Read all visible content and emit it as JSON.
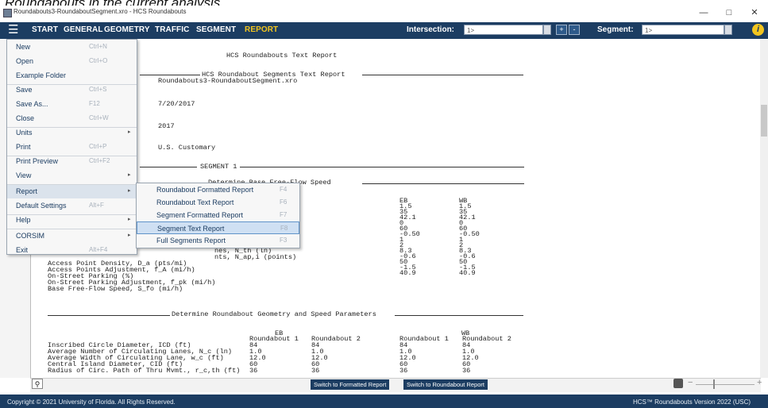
{
  "caption": "Roundabouts in the current analysis.",
  "window": {
    "title": "Roundabouts3-RoundaboutSegment.xro - HCS Roundabouts",
    "controls": {
      "minimize": "—",
      "maximize": "□",
      "close": "✕"
    }
  },
  "ribbon": {
    "menu_icon": "hamburger-icon",
    "tabs": [
      "START",
      "GENERAL",
      "GEOMETRY",
      "TRAFFIC",
      "SEGMENT",
      "REPORT"
    ],
    "active_tab": "REPORT",
    "intersection_label": "Intersection:",
    "intersection_value": "1>",
    "segment_label": "Segment:",
    "segment_value": "1>",
    "add_label": "+",
    "remove_label": "-",
    "info_label": "i"
  },
  "file_menu": {
    "items": [
      {
        "label": "New",
        "shortcut": "Ctrl+N"
      },
      {
        "label": "Open",
        "shortcut": "Ctrl+O"
      },
      {
        "label": "Example Folder",
        "shortcut": ""
      },
      {
        "label": "Save",
        "shortcut": "Ctrl+S"
      },
      {
        "label": "Save As...",
        "shortcut": "F12"
      },
      {
        "label": "Close",
        "shortcut": "Ctrl+W"
      },
      {
        "label": "Units",
        "shortcut": ""
      },
      {
        "label": "Print",
        "shortcut": "Ctrl+P"
      },
      {
        "label": "Print Preview",
        "shortcut": "Ctrl+F2"
      },
      {
        "label": "View",
        "shortcut": ""
      },
      {
        "label": "Report",
        "shortcut": ""
      },
      {
        "label": "Default Settings",
        "shortcut": "Alt+F"
      },
      {
        "label": "Help",
        "shortcut": ""
      },
      {
        "label": "CORSIM",
        "shortcut": ""
      },
      {
        "label": "Exit",
        "shortcut": "Alt+F4"
      }
    ]
  },
  "report_submenu": {
    "items": [
      {
        "label": "Roundabout Formatted Report",
        "shortcut": "F4"
      },
      {
        "label": "Roundabout Text Report",
        "shortcut": "F6"
      },
      {
        "label": "Segment Formatted Report",
        "shortcut": "F7"
      },
      {
        "label": "Segment Text Report",
        "shortcut": "F8"
      },
      {
        "label": "Full Segments Report",
        "shortcut": "F3"
      }
    ],
    "selected": "Segment Text Report"
  },
  "report": {
    "main_title": "HCS Roundabouts Text Report",
    "segments_title": "HCS Roundabout Segments Text Report",
    "file_name": "Roundabouts3-RoundaboutSegment.xro",
    "date": "7/20/2017",
    "year": "2017",
    "units": "U.S. Customary",
    "segment_heading": "SEGMENT 1",
    "ffs_heading": "Determine Base Free-Flow Speed",
    "dir_headers": [
      "EB",
      "WB"
    ],
    "ffs_values": {
      "eb": [
        "1.5",
        "35",
        "42.1",
        "0",
        "60",
        "-0.50",
        "1",
        "2",
        "8.3",
        "-0.6",
        "50",
        "-1.5",
        "40.9"
      ],
      "wb": [
        "1.5",
        "35",
        "42.1",
        "0",
        "60",
        "-0.50",
        "1",
        "2",
        "8.3",
        "-0.6",
        "50",
        "-1.5",
        "40.9"
      ]
    },
    "ffs_labels": [
      "nes, N_th (ln)",
      "nts, N_ap,i (points)",
      "Access Point Density, D_a (pts/mi)",
      "Access Points Adjustment, f_A (mi/h)",
      "On-Street Parking (%)",
      "On-Street Parking Adjustment, f_pk (mi/h)",
      "Base Free-Flow Speed, S_fo (mi/h)"
    ],
    "geometry_heading": "Determine Roundabout Geometry and Speed Parameters",
    "geometry_headers": [
      "Roundabout 1",
      "Roundabout 2",
      "Roundabout 1",
      "Roundabout 2"
    ],
    "geometry_rows": [
      {
        "label": "Inscribed Circle Diameter, ICD (ft)",
        "values": [
          "84",
          "84",
          "84",
          "84"
        ]
      },
      {
        "label": "Average Number of Circulating Lanes, N_c (ln)",
        "values": [
          "1.0",
          "1.0",
          "1.0",
          "1.0"
        ]
      },
      {
        "label": "Average Width of Circulating Lane, w_c (ft)",
        "values": [
          "12.0",
          "12.0",
          "12.0",
          "12.0"
        ]
      },
      {
        "label": "Central Island Diameter, CID (ft)",
        "values": [
          "60",
          "60",
          "60",
          "60"
        ]
      },
      {
        "label": "Radius of Circ. Path of Thru Mvmt., r_c,th (ft)",
        "values": [
          "36",
          "36",
          "36",
          "36"
        ]
      }
    ]
  },
  "bottom": {
    "search_icon": "search-icon",
    "switch_formatted": "Switch to Formatted Report",
    "switch_roundabout": "Switch to Roundabout Report",
    "zoom_minus": "−",
    "zoom_plus": "+"
  },
  "status": {
    "copyright": "Copyright © 2021 University of Florida. All Rights Reserved.",
    "version": "HCS™ Roundabouts Version 2022 (USC)"
  }
}
